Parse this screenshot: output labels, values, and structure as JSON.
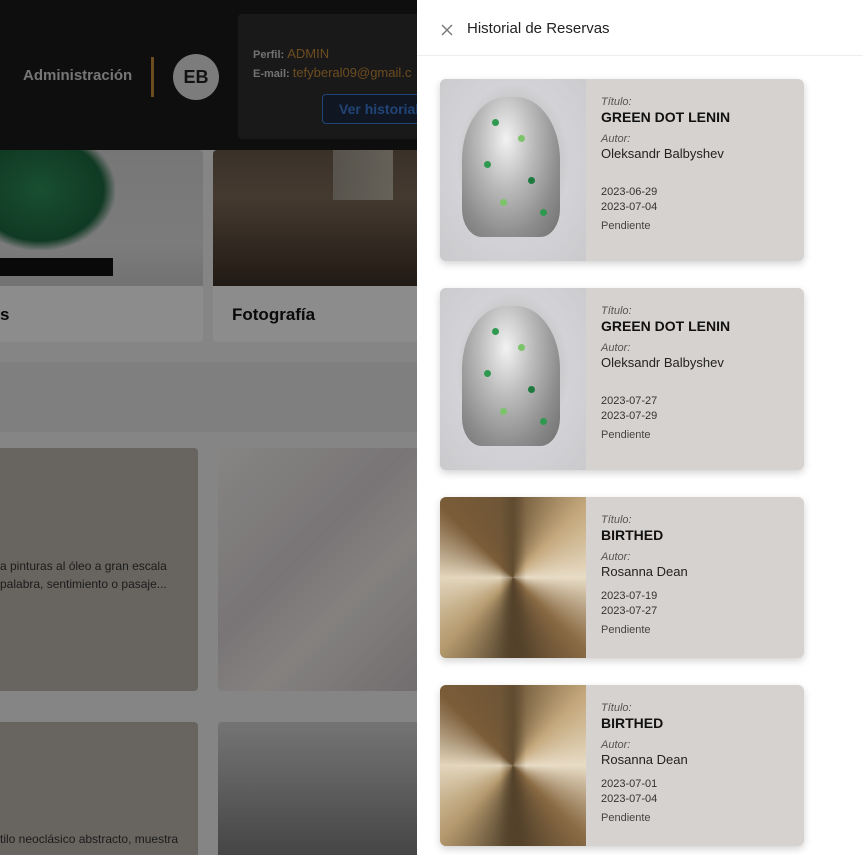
{
  "header": {
    "admin_label": "Administración",
    "avatar_initials": "EB",
    "profile": {
      "perfil_label": "Perfil:",
      "perfil_value": "ADMIN",
      "email_label": "E-mail:",
      "email_value": "tefyberal09@gmail.c",
      "history_button": "Ver historial"
    }
  },
  "categories": [
    {
      "label": "s"
    },
    {
      "label": "Fotografía"
    }
  ],
  "artworks": [
    {
      "desc_line1": "a pinturas al óleo a gran escala",
      "desc_line2": "palabra, sentimiento o pasaje..."
    },
    {
      "desc_line1": "tilo neoclásico abstracto, muestra"
    }
  ],
  "drawer": {
    "title": "Historial de Reservas",
    "title_label": "Título:",
    "author_label": "Autor:",
    "reservations": [
      {
        "title": "GREEN DOT LENIN",
        "author": "Oleksandr Balbyshev",
        "start": "2023-06-29",
        "end": "2023-07-04",
        "status": "Pendiente",
        "image": "lenin"
      },
      {
        "title": "GREEN DOT LENIN",
        "author": "Oleksandr Balbyshev",
        "start": "2023-07-27",
        "end": "2023-07-29",
        "status": "Pendiente",
        "image": "lenin"
      },
      {
        "title": "BIRTHED",
        "author": "Rosanna Dean",
        "start": "2023-07-19",
        "end": "2023-07-27",
        "status": "Pendiente",
        "image": "birthed"
      },
      {
        "title": "BIRTHED",
        "author": "Rosanna Dean",
        "start": "2023-07-01",
        "end": "2023-07-04",
        "status": "Pendiente",
        "image": "birthed"
      }
    ]
  },
  "colors": {
    "accent": "#c78a3a",
    "button_blue": "#3d7dd8",
    "card_bg": "#d6d2cf"
  }
}
